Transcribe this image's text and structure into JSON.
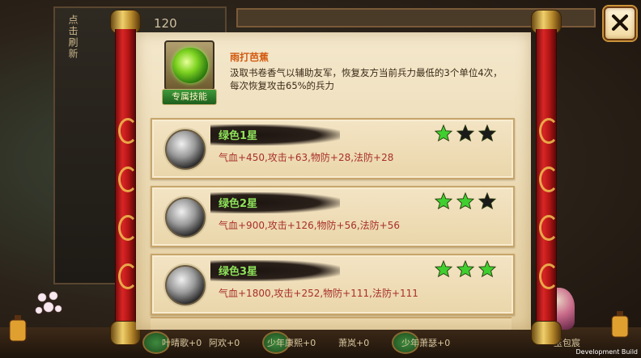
{
  "background": {
    "left_vertical_text": "点击刷新",
    "left_value": "120",
    "bottom_items": [
      "叶晴歌+0",
      "阿欢+0",
      "少年康熙+0",
      "萧岚+0",
      "少年萧瑟+0"
    ],
    "character_label": "玉包宸",
    "dev_build_label": "Development Build"
  },
  "skill": {
    "name": "雨打芭蕉",
    "description": "汲取书卷香气以辅助友军，恢复友方当前兵力最低的3个单位4次，每次恢复攻击65%的兵力",
    "tag_label": "专属技能"
  },
  "tiers": [
    {
      "title": "绿色1星",
      "stats": "气血+450,攻击+63,物防+28,法防+28",
      "stars_filled": 1,
      "stars_total": 3
    },
    {
      "title": "绿色2星",
      "stats": "气血+900,攻击+126,物防+56,法防+56",
      "stars_filled": 2,
      "stars_total": 3
    },
    {
      "title": "绿色3星",
      "stats": "气血+1800,攻击+252,物防+111,法防+111",
      "stars_filled": 3,
      "stars_total": 3
    }
  ],
  "colors": {
    "star_filled": "#3fcf2f",
    "star_empty": "#1a1a1a",
    "tier_title": "#8ee25a",
    "stats_text": "#a8302a",
    "skill_name": "#d35a10"
  },
  "icons": {
    "close": "close-x-icon",
    "skill": "green-leaf-skill-icon",
    "tier": "white-brush-tier-icon",
    "star": "star-icon"
  }
}
